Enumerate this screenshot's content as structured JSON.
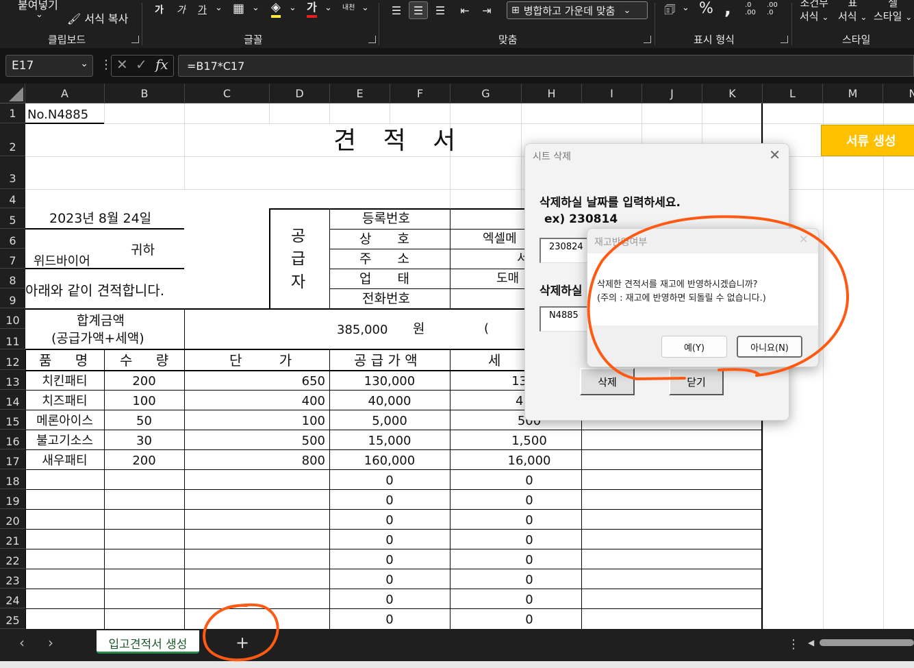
{
  "ribbon": {
    "clipboard": {
      "paste": "붙여넣기",
      "format_painter": "서식 복사",
      "label": "클립보드"
    },
    "font": {
      "grow": "가",
      "shrink": "가",
      "phonetic": "가",
      "font_color_glyph": "가",
      "label": "글꼴"
    },
    "align": {
      "wrap_glyph": "내천",
      "merge": "병합하고 가운데 맞춤",
      "label": "맞춤"
    },
    "number": {
      "percent": "%",
      "comma": ",",
      "inc_decimal": ".0 .00",
      "dec_decimal": ".00 .0",
      "label": "표시 형식"
    },
    "styles": {
      "cond": "조건부",
      "cond2": "서식",
      "table": "표",
      "table2": "서식",
      "cell": "셀",
      "cell2": "스타일",
      "label": "스타일"
    }
  },
  "formula_bar": {
    "name_box": "E17",
    "fx": "fx",
    "formula": "=B17*C17"
  },
  "columns": [
    "A",
    "B",
    "C",
    "D",
    "E",
    "F",
    "G",
    "H",
    "I",
    "J",
    "K",
    "L",
    "M",
    "N"
  ],
  "rows": [
    "1",
    "2",
    "3",
    "4",
    "5",
    "6",
    "7",
    "8",
    "9",
    "10",
    "11",
    "12",
    "13",
    "14",
    "15",
    "16",
    "17",
    "18",
    "19",
    "20",
    "21",
    "22",
    "23",
    "24",
    "25"
  ],
  "sheet": {
    "doc_no": "No.N4885",
    "title": "견 적 서",
    "date": "2023년 8월 24일",
    "recipient": "위드바이어",
    "honorific": "귀하",
    "greeting": "아래와 같이 견적합니다.",
    "supplier_label": [
      "공",
      "급",
      "자"
    ],
    "supplier_fields": [
      "등록번호",
      "상 호",
      "주 소",
      "업 태",
      "전화번호"
    ],
    "supplier_values": [
      "",
      "엑셀메",
      "서",
      "도매",
      ""
    ],
    "total_label": "합계금액",
    "total_sub": "(공급가액+세액)",
    "total_value": "385,000",
    "total_unit": "원",
    "total_paren": "(",
    "table_headers": [
      "품 명",
      "수 량",
      "단 가",
      "공 급 가 액",
      "세"
    ],
    "items": [
      {
        "name": "치킨패티",
        "qty": "200",
        "price": "650",
        "supply": "130,000",
        "tax": "13,00"
      },
      {
        "name": "치즈패티",
        "qty": "100",
        "price": "400",
        "supply": "40,000",
        "tax": "4,00"
      },
      {
        "name": "메론아이스",
        "qty": "50",
        "price": "100",
        "supply": "5,000",
        "tax": "500"
      },
      {
        "name": "불고기소스",
        "qty": "30",
        "price": "500",
        "supply": "15,000",
        "tax": "1,500"
      },
      {
        "name": "새우패티",
        "qty": "200",
        "price": "800",
        "supply": "160,000",
        "tax": "16,000"
      },
      {
        "name": "",
        "qty": "",
        "price": "",
        "supply": "0",
        "tax": "0"
      },
      {
        "name": "",
        "qty": "",
        "price": "",
        "supply": "0",
        "tax": "0"
      },
      {
        "name": "",
        "qty": "",
        "price": "",
        "supply": "0",
        "tax": "0"
      },
      {
        "name": "",
        "qty": "",
        "price": "",
        "supply": "0",
        "tax": "0"
      },
      {
        "name": "",
        "qty": "",
        "price": "",
        "supply": "0",
        "tax": "0"
      },
      {
        "name": "",
        "qty": "",
        "price": "",
        "supply": "0",
        "tax": "0"
      },
      {
        "name": "",
        "qty": "",
        "price": "",
        "supply": "0",
        "tax": "0"
      },
      {
        "name": "",
        "qty": "",
        "price": "",
        "supply": "0",
        "tax": "0"
      }
    ],
    "generate_button": "서류 생성"
  },
  "delete_dialog": {
    "title": "시트 삭제",
    "prompt_date": "삭제하실 날짜를 입력하세요.",
    "example": "ex) 230814",
    "date_value": "230824",
    "prompt_doc": "삭제하실",
    "doc_value": "N4885",
    "delete_btn": "삭제",
    "close_btn": "닫기"
  },
  "confirm_dialog": {
    "title": "재고반영여부",
    "line1": "삭제한 견적서를 재고에 반영하시겠습니까?",
    "line2": "(주의 : 재고에 반영하면 되돌릴 수 없습니다.)",
    "yes": "예(Y)",
    "no": "아니요(N)"
  },
  "tabs": {
    "active": "입고견적서 생성",
    "add": "+"
  },
  "colors": {
    "accent_button": "#ffc000",
    "annotation": "#ff5a14",
    "ribbon_bg": "#1f1f1f"
  }
}
